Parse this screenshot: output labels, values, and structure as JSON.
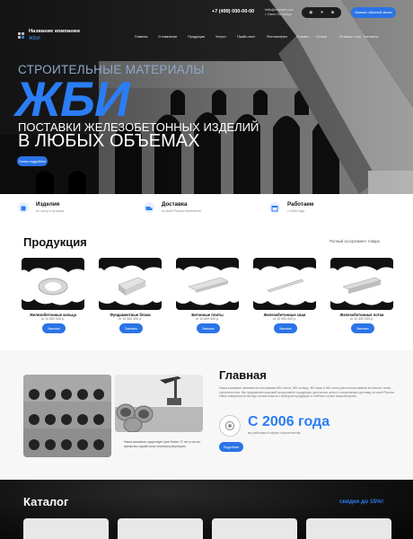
{
  "header": {
    "company_name": "Название компании",
    "company_tag": "ЖБИ",
    "phone": "+7 (499) 000-00-00",
    "email": "hello@example.com",
    "city": "г. Санкт-Петербург",
    "callback_label": "Заказать обратный звонок",
    "social_icons": [
      "whatsapp-icon",
      "telegram-icon",
      "vk-icon"
    ]
  },
  "nav": {
    "items": [
      "Главная",
      "О компании",
      "Продукция",
      "Услуги",
      "Прайс-лист",
      "Фотогалерея",
      "Отзывы",
      "Статьи",
      "Отзывы о нас",
      "Контакты"
    ]
  },
  "hero": {
    "kicker": "СТРОИТЕЛЬНЫЕ МАТЕРИАЛЫ",
    "big": "ЖБИ",
    "line1": "ПОСТАВКИ ЖЕЛЕЗОБЕТОННЫХ ИЗДЕЛИЙ",
    "line2": "В ЛЮБЫХ ОБЪЕМАХ",
    "cta": "Узнать подробнее"
  },
  "features": [
    {
      "title": "Изделия",
      "sub": "по госту и на заказ",
      "icon": "box-icon"
    },
    {
      "title": "Доставка",
      "sub": "по всей России бесплатно",
      "icon": "truck-icon"
    },
    {
      "title": "Работаем",
      "sub": "с 2006 года",
      "icon": "calendar-icon"
    }
  ],
  "products": {
    "title": "Продукция",
    "link": "Полный ассортимент товара",
    "button_label": "Заказать",
    "items": [
      {
        "name": "Железобетонные кольца",
        "price": "от 10 500 000 р."
      },
      {
        "name": "Фундаментные блоки",
        "price": "от 10 500 000 р."
      },
      {
        "name": "Бетонные плиты",
        "price": "от 10 800 000 р."
      },
      {
        "name": "Железобетонные сваи",
        "price": "от 10 500 000 р."
      },
      {
        "name": "Железобетонные лотки",
        "price": "от 10 500 000 р."
      }
    ]
  },
  "about": {
    "title": "Главная",
    "text": "Наша компания занимается поставками ЖБ плиты, ЖБ кольца, ЖБ сваи и ЖБ лотки для использования во многих типах строительства. Мы предлагаем широкий ассортимент продукции, доступные цены и оперативную доставку по всей России. Наши специалисты всегда готовы помочь с выбором продукции и ответить на все ваши вопросы.",
    "caption": "Наша компания существует уже более 17 лет и за это время мы заработали отличную репутацию",
    "since_big": "С 2006 года",
    "since_sub": "мы работаем в сфере строительства",
    "button_label": "Подробнее"
  },
  "catalog": {
    "title": "Каталог",
    "discount": "скидки до 15%!"
  }
}
